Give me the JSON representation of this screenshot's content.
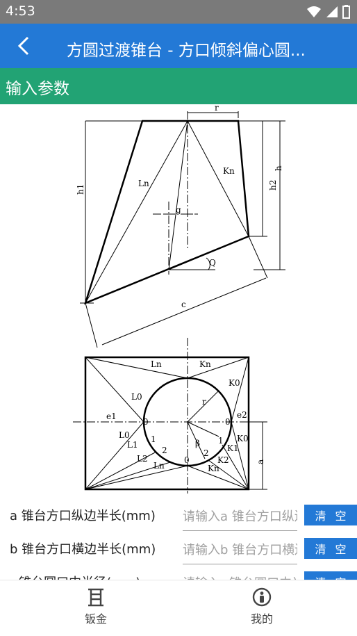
{
  "status": {
    "time": "4:53"
  },
  "appbar": {
    "title": "方圆过渡锥台 - 方口倾斜偏心圆..."
  },
  "section": {
    "title": "输入参数"
  },
  "diagram": {
    "labels": {
      "r": "r",
      "h": "h",
      "h1": "h1",
      "h2": "h2",
      "g": "g",
      "Q": "Q",
      "c": "c",
      "Ln": "Ln",
      "Kn": "Kn",
      "Ln2": "Ln",
      "Kn2": "Kn",
      "K0": "K0",
      "L0": "L0",
      "e1": "e1",
      "e2": "e2",
      "zero_l": "0",
      "zero_r": "0",
      "zero_b": "0",
      "L0b": "L0",
      "L1": "L1",
      "L2": "L2",
      "Lnb": "Ln",
      "K0b": "K0",
      "K1": "K1",
      "K2": "K2",
      "Knb": "Kn",
      "one_l": "1",
      "two_l": "2",
      "one_r": "1",
      "two_r": "2",
      "beta": "β",
      "rr": "r",
      "a": "a"
    }
  },
  "fields": [
    {
      "label": "a 锥台方口纵边半长(mm)",
      "placeholder": "请输入a 锥台方口纵边半长",
      "clear": "清 空"
    },
    {
      "label": "b 锥台方口横边半长(mm)",
      "placeholder": "请输入b 锥台方口横边半长",
      "clear": "清 空"
    },
    {
      "label": "r 锥台圆口中半径(mm)",
      "placeholder": "请输入r 锥台圆口中半径",
      "clear": "清 空"
    }
  ],
  "nav": [
    {
      "label": "钣金",
      "icon": "sheet-metal-icon"
    },
    {
      "label": "我的",
      "icon": "profile-icon"
    }
  ],
  "colors": {
    "appbar": "#2379d6",
    "section": "#22a374",
    "status": "#7a7a7a"
  }
}
